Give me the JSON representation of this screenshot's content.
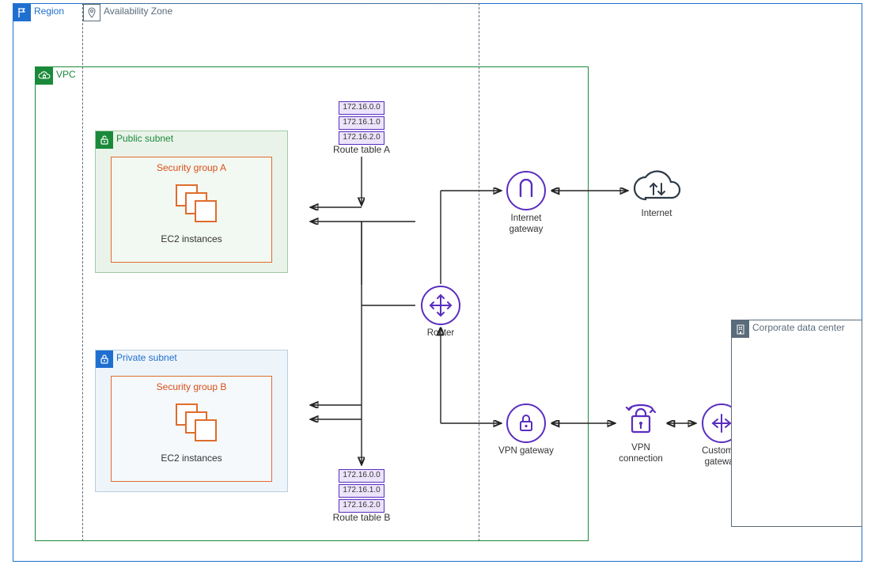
{
  "region": {
    "label": "Region"
  },
  "az": {
    "label": "Availability Zone"
  },
  "vpc": {
    "label": "VPC"
  },
  "public_subnet": {
    "label": "Public subnet"
  },
  "private_subnet": {
    "label": "Private subnet"
  },
  "sg_a": {
    "title": "Security group A",
    "caption": "EC2 instances"
  },
  "sg_b": {
    "title": "Security group B",
    "caption": "EC2 instances"
  },
  "route_table_a": {
    "label": "Route table A",
    "rows": [
      "172.16.0.0",
      "172.16.1.0",
      "172.16.2.0"
    ]
  },
  "route_table_b": {
    "label": "Route table B",
    "rows": [
      "172.16.0.0",
      "172.16.1.0",
      "172.16.2.0"
    ]
  },
  "router": {
    "label": "Router"
  },
  "internet_gateway": {
    "label": "Internet gateway"
  },
  "internet": {
    "label": "Internet"
  },
  "vpn_gateway": {
    "label": "VPN gateway"
  },
  "vpn_connection": {
    "label": "VPN connection"
  },
  "customer_gateway": {
    "label": "Customer gateway"
  },
  "corporate_dc": {
    "label": "Corporate data center"
  }
}
